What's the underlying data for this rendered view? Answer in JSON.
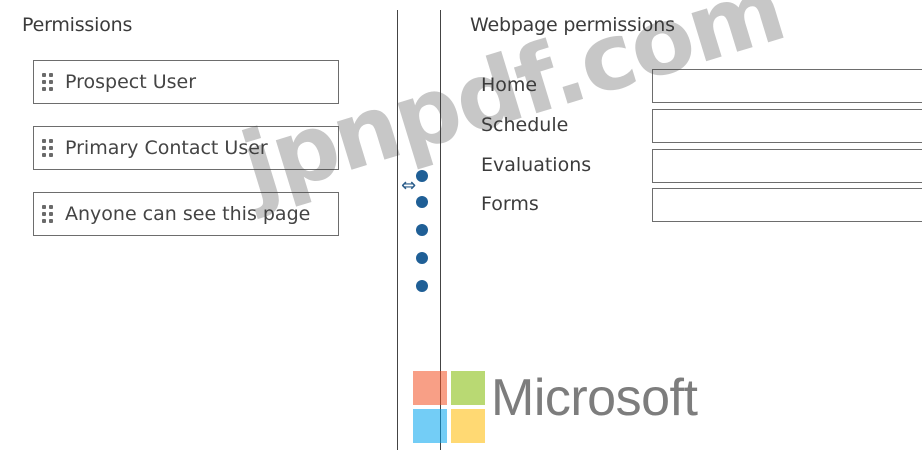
{
  "left_panel": {
    "title": "Permissions",
    "roles": [
      {
        "label": "Prospect User"
      },
      {
        "label": "Primary Contact User"
      },
      {
        "label": "Anyone can see this page"
      }
    ]
  },
  "right_panel": {
    "title": "Webpage permissions",
    "pages": [
      {
        "label": "Home",
        "value": ""
      },
      {
        "label": "Schedule",
        "value": ""
      },
      {
        "label": "Evaluations",
        "value": ""
      },
      {
        "label": "Forms",
        "value": ""
      }
    ]
  },
  "splitter": {
    "icon": "drag-handle-icon",
    "arrow_glyph": "⇔",
    "accent": "#1f5f96"
  },
  "watermark": {
    "text": "jpnpdf.com"
  },
  "branding": {
    "wordmark": "Microsoft",
    "logo_colors": [
      "#f25022",
      "#7fba00",
      "#00a4ef",
      "#ffb900"
    ]
  }
}
